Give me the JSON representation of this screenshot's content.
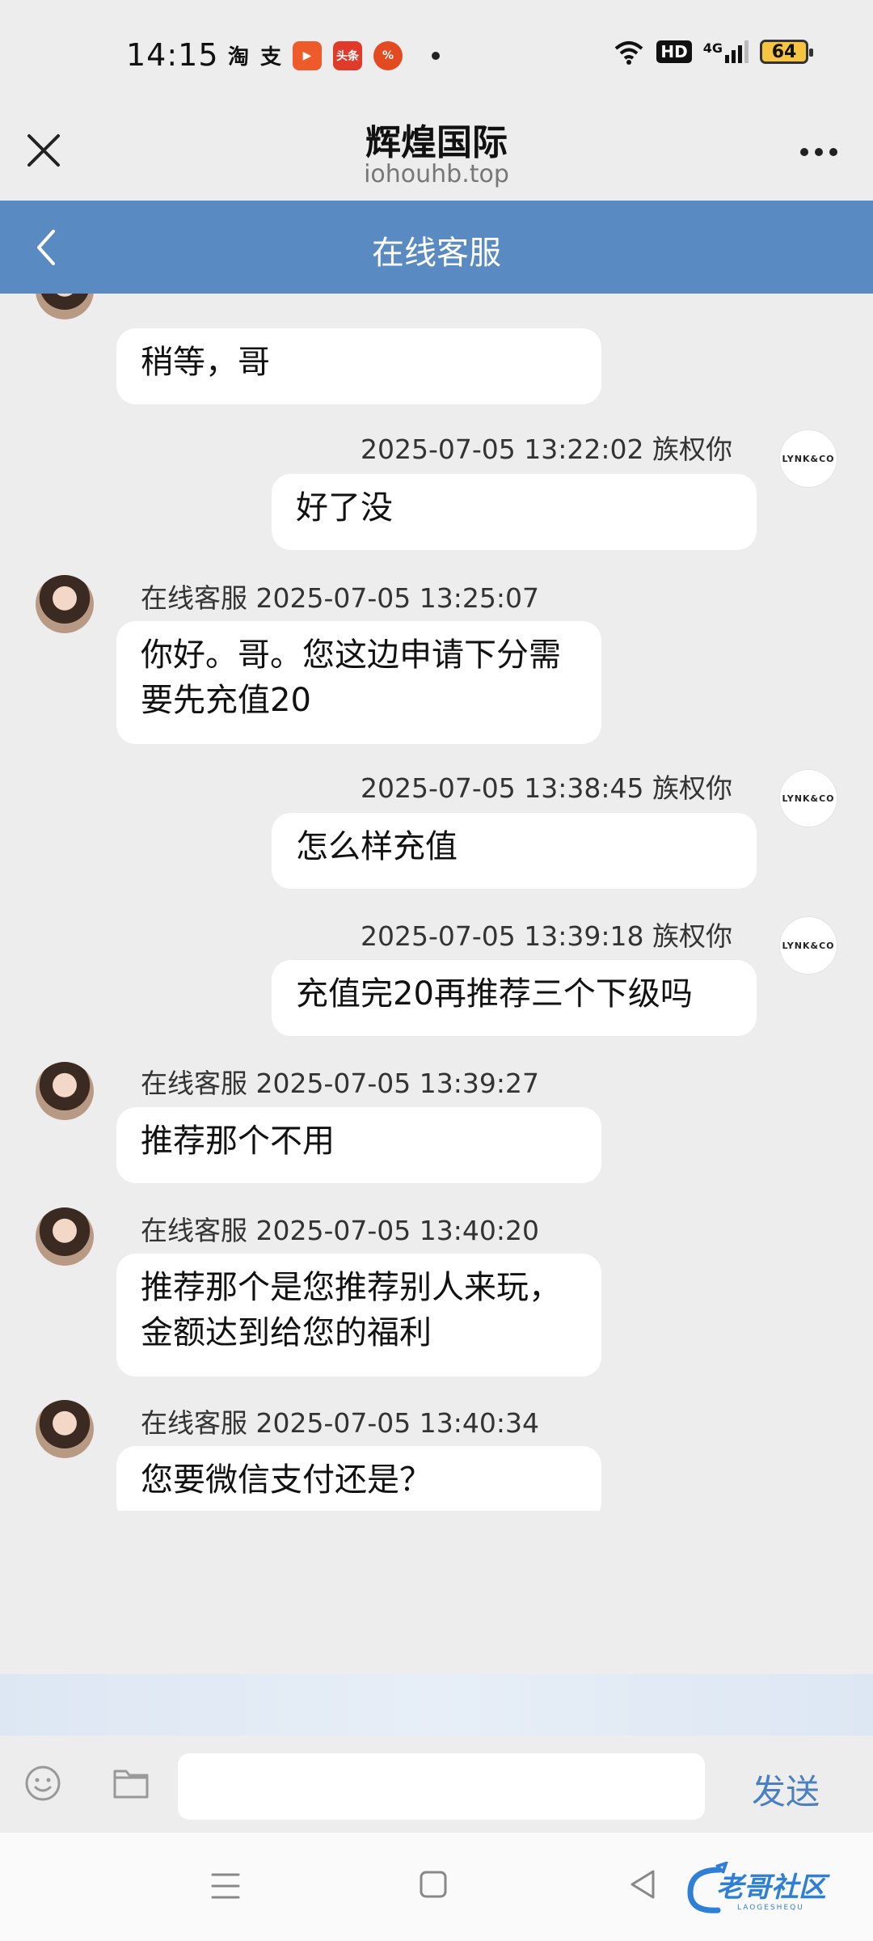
{
  "status_bar": {
    "time": "14:15",
    "apps": [
      "淘",
      "支"
    ],
    "app_tiles": [
      {
        "label": "▶",
        "color": "#ef5a2a"
      },
      {
        "label": "头条",
        "color": "#e03a2b"
      },
      {
        "label": "%",
        "color": "#e34a1f"
      }
    ],
    "network_badge": "HD",
    "network_type": "4G",
    "battery": "64"
  },
  "titlebar": {
    "title": "辉煌国际",
    "subtitle": "iohouhb.top"
  },
  "chat_header": {
    "title": "在线客服"
  },
  "user_avatar_text": "LYNK&CO",
  "messages": [
    {
      "side": "agent",
      "meta": "",
      "text": "稍等，哥"
    },
    {
      "side": "user",
      "meta": "2025-07-05 13:22:02 族权你",
      "text": "好了没"
    },
    {
      "side": "agent",
      "meta": "在线客服 2025-07-05 13:25:07",
      "text": "你好。哥。您这边申请下分需要先充值20"
    },
    {
      "side": "user",
      "meta": "2025-07-05 13:38:45 族权你",
      "text": "怎么样充值"
    },
    {
      "side": "user",
      "meta": "2025-07-05 13:39:18 族权你",
      "text": "充值完20再推荐三个下级吗"
    },
    {
      "side": "agent",
      "meta": "在线客服 2025-07-05 13:39:27",
      "text": "推荐那个不用"
    },
    {
      "side": "agent",
      "meta": "在线客服 2025-07-05 13:40:20",
      "text": "推荐那个是您推荐别人来玩，金额达到给您的福利"
    },
    {
      "side": "agent",
      "meta": "在线客服 2025-07-05 13:40:34",
      "text": "您要微信支付还是？"
    }
  ],
  "input": {
    "value": "",
    "send_label": "发送"
  },
  "watermark": {
    "text": "老哥社区",
    "subtext": "LAOGESHEQU"
  }
}
